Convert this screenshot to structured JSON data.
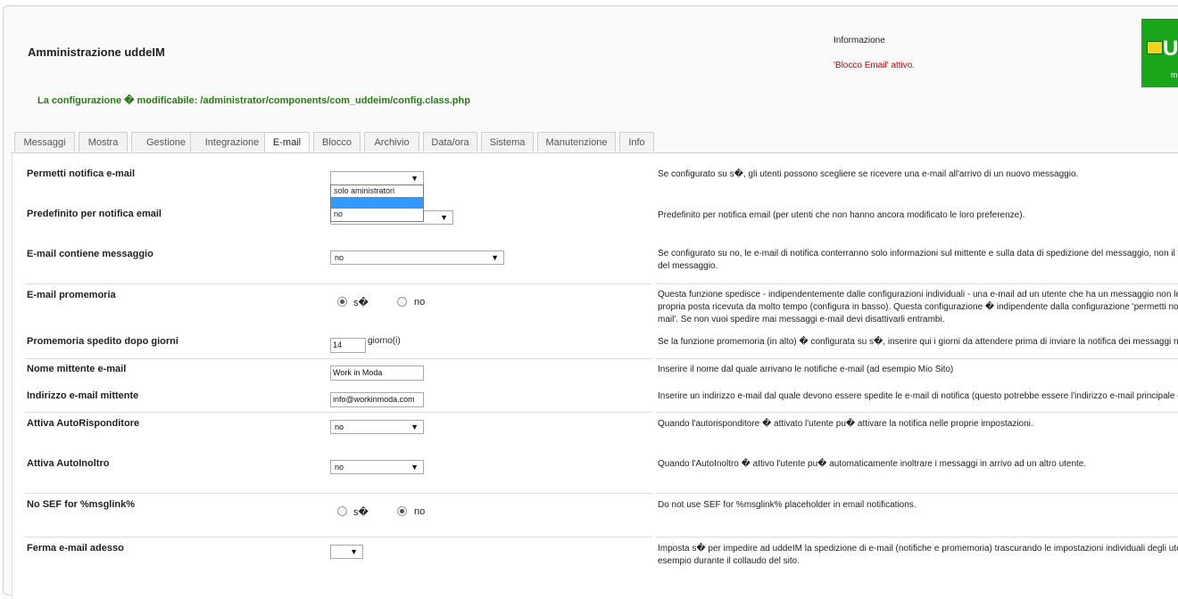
{
  "header": {
    "title": "Amministrazione uddeIM",
    "config_notice": "La configurazione � modificabile: /administrator/components/com_uddeim/config.class.php",
    "info_title": "Informazione",
    "info_message": "'Blocco Email' attivo.",
    "logo_text": "U",
    "logo_subtext": "m"
  },
  "tabs": [
    "Messaggi",
    "Mostra",
    "Gestione",
    "Integrazione",
    "E-mail",
    "Blocco",
    "Archivio",
    "Data/ora",
    "Sistema",
    "Manutenzione",
    "Info"
  ],
  "active_tab": "E-mail",
  "settings": {
    "notify": {
      "label": "Permetti notifica e-mail",
      "value": "",
      "desc": "Se configurato su s�, gli utenti possono scegliere se ricevere una e-mail all'arrivo di un nuovo messaggio.",
      "options": [
        "solo aministratori",
        "",
        "no"
      ]
    },
    "default_notify": {
      "label": "Predefinito per notifica email",
      "value": "",
      "desc": "Predefinito per notifica email (per utenti che non hanno ancora modificato le loro preferenze)."
    },
    "email_contains": {
      "label": "E-mail contiene messaggio",
      "value": "no",
      "desc1": "Se configurato su no, le e-mail di notifica conterranno solo informazioni sul mittente e sulla data di spedizione del messaggio, non il testo",
      "desc2": "del messaggio."
    },
    "reminder": {
      "label": "E-mail promemoria",
      "yes": "s�",
      "no": "no",
      "desc1": "Questa funzione spedisce - indipendentemente dalle configurazioni individuali - una e-mail ad un utente che ha un messaggio non letto nella",
      "desc2": "propria posta ricevuta da molto tempo (configura in basso). Questa configurazione � indipendente dalla configurazione 'permetti notifica e-",
      "desc3": "mail'. Se non vuoi spedire mai messaggi e-mail devi disattivarli entrambi."
    },
    "reminder_days": {
      "label": "Promemoria spedito dopo giorni",
      "value": "14",
      "unit": "giorno(i)",
      "desc": "Se la funzione promemoria (in alto) � configurata su s�, inserire qui i giorni da attendere prima di inviare la notifica dei messaggi non letti."
    },
    "sender_name": {
      "label": "Nome mittente e-mail",
      "value": "Work in Moda",
      "desc": "Inserire il nome dal quale arrivano le notifiche e-mail (ad esempio Mio Sito)"
    },
    "sender_address": {
      "label": "Indirizzo e-mail mittente",
      "value": "info@workinmoda.com",
      "desc": "Inserire un indirizzo e-mail dal quale devono essere spedite le e-mail di notifica (questo potrebbe essere l'indirizzo e-mail principale del sito."
    },
    "autoresponder": {
      "label": "Attiva AutoRisponditore",
      "value": "no",
      "desc": "Quando l'autorisponditore � attivato l'utente pu� attivare la notifica nelle proprie impostazioni."
    },
    "autoforward": {
      "label": "Attiva AutoInoltro",
      "value": "no",
      "desc": "Quando l'AutoInoltro � attivo l'utente pu� automaticamente inoltrare i messaggi in arrivo ad un altro utente."
    },
    "no_sef": {
      "label": "No SEF for %msglink%",
      "yes": "s�",
      "no": "no",
      "desc": "Do not use SEF for %msglink% placeholder in email notifications."
    },
    "stop_email": {
      "label": "Ferma e-mail adesso",
      "value": "",
      "desc1": "Imposta s� per impedire ad uddeIM la spedizione di e-mail (notifiche e promemoria) trascurando le impostazioni individuali degli utenti, ad",
      "desc2": "esempio durante il collaudo del sito."
    }
  },
  "colors": {
    "accent_green": "#2a7b14",
    "alert_red": "#cc0000",
    "highlight_blue": "#3399ff",
    "logo_green": "#1aa61a"
  }
}
